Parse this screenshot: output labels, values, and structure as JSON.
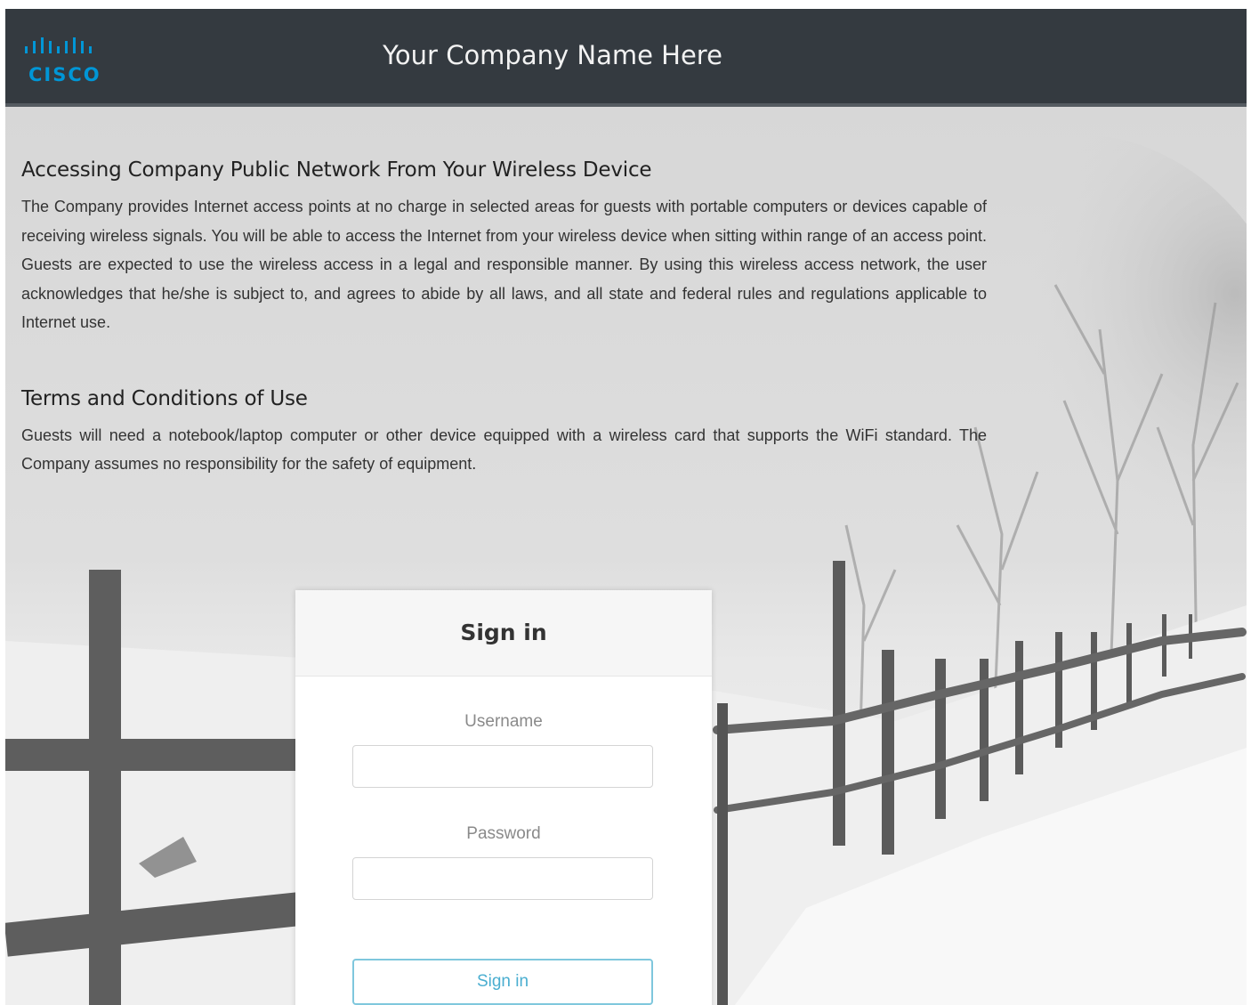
{
  "header": {
    "logo_text": "CISCO",
    "company_name": "Your Company Name Here"
  },
  "sections": [
    {
      "title": "Accessing Company Public Network From Your Wireless Device",
      "body": "The Company provides Internet access points at no charge in selected areas for guests with portable computers or devices capable of receiving wireless signals. You will be able to access the Internet from your wireless device when sitting within range of an access point. Guests are expected to use the wireless access in a legal and responsible manner. By using this wireless access network, the user acknowledges that he/she is subject to, and agrees to abide by all laws, and all state and federal rules and regulations applicable to Internet use."
    },
    {
      "title": "Terms and Conditions of Use",
      "body": "Guests will need a notebook/laptop computer or other device equipped with a wireless card that supports the WiFi standard. The Company assumes no responsibility for the safety of equipment."
    }
  ],
  "signin": {
    "title": "Sign in",
    "username_label": "Username",
    "username_value": "",
    "password_label": "Password",
    "password_value": "",
    "button_label": "Sign in"
  },
  "colors": {
    "header_bg": "#343a40",
    "logo_blue": "#0096d6",
    "button_accent": "#4aaed0"
  },
  "background_image": "snowy-field-fence-image"
}
